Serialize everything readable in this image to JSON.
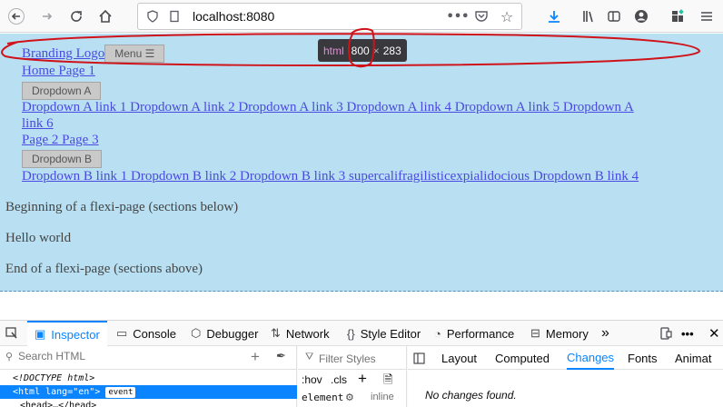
{
  "browser": {
    "url": "localhost:8080",
    "more_label": "•••"
  },
  "page": {
    "branding": "Branding Logo",
    "menu_button": "Menu ☰",
    "home_line": "Home Page 1",
    "dropdown_a": "Dropdown A",
    "dropdown_a_links_1": "Dropdown A link 1 Dropdown A link 2 Dropdown A link 3 Dropdown A link 4 Dropdown A link 5 Dropdown A",
    "dropdown_a_links_2": "link 6",
    "page_line": "Page 2 Page 3",
    "dropdown_b": "Dropdown B",
    "dropdown_b_links": "Dropdown B link 1 Dropdown B link 2 Dropdown B link 3 supercalifragilisticexpialidocious Dropdown B link 4",
    "para1": "Beginning of a flexi-page (sections below)",
    "para2": "Hello world",
    "para3": "End of a flexi-page (sections above)"
  },
  "tooltip": {
    "tag": "html",
    "width": "800",
    "times": "×",
    "height": "283"
  },
  "devtools": {
    "tabs": [
      {
        "label": "Inspector",
        "icon": "inspector-icon"
      },
      {
        "label": "Console",
        "icon": "console-icon"
      },
      {
        "label": "Debugger",
        "icon": "debugger-icon"
      },
      {
        "label": "Network",
        "icon": "network-icon"
      },
      {
        "label": "Style Editor",
        "icon": "style-editor-icon"
      },
      {
        "label": "Performance",
        "icon": "performance-icon"
      },
      {
        "label": "Memory",
        "icon": "memory-icon"
      }
    ],
    "search_placeholder": "Search HTML",
    "filter_placeholder": "Filter Styles",
    "markup": {
      "doctype": "<!DOCTYPE html>",
      "html_open": "<html lang=\"en\">",
      "event_badge": "event",
      "head": "<head>…</head>"
    },
    "rule_tools": {
      "hov": ":hov",
      "cls": ".cls"
    },
    "element_label": "element",
    "inline_label": "inline",
    "sub_tabs": [
      "Layout",
      "Computed",
      "Changes",
      "Fonts",
      "Animat"
    ],
    "active_sub_tab": "Changes",
    "no_changes": "No changes found."
  },
  "colors": {
    "page_bg": "#b8e0f2",
    "link": "#4a4ae0",
    "annotation": "#d0131a",
    "accent": "#0a84ff"
  }
}
